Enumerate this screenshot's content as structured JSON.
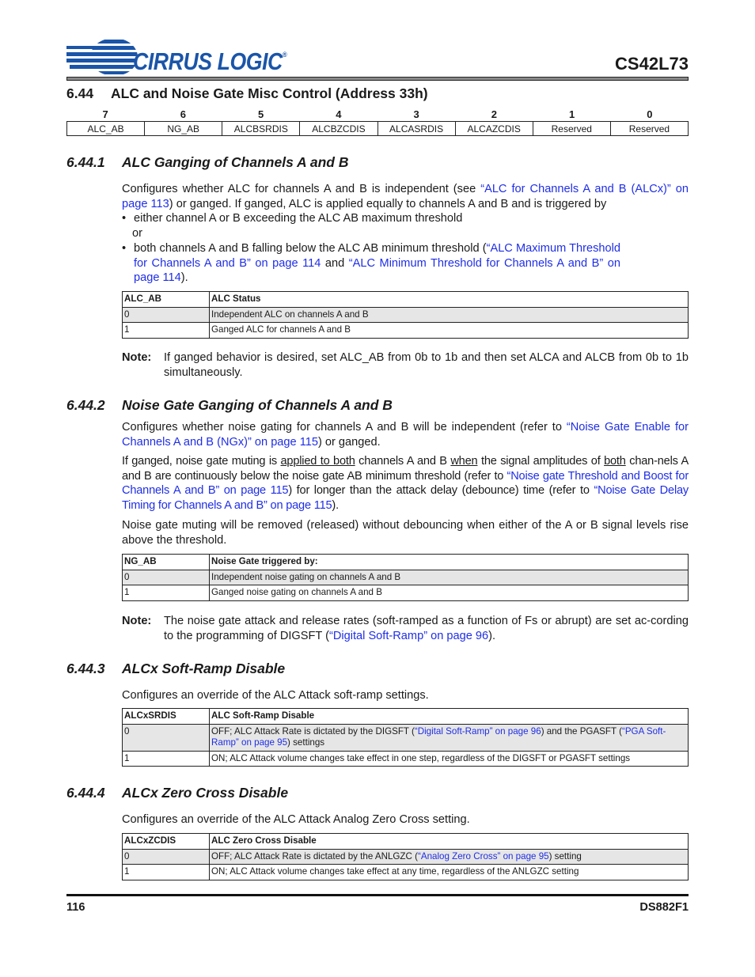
{
  "header": {
    "logo_text": "CIRRUS LOGIC",
    "logo_mark": "®",
    "part_number": "CS42L73"
  },
  "section": {
    "number": "6.44",
    "title": "ALC and Noise Gate Misc Control (Address 33h)"
  },
  "register": {
    "bits": [
      "7",
      "6",
      "5",
      "4",
      "3",
      "2",
      "1",
      "0"
    ],
    "fields": [
      "ALC_AB",
      "NG_AB",
      "ALCBSRDIS",
      "ALCBZCDIS",
      "ALCASRDIS",
      "ALCAZCDIS",
      "Reserved",
      "Reserved"
    ]
  },
  "sub1": {
    "number": "6.44.1",
    "title": "ALC Ganging of Channels A and B",
    "p1_a": "Configures whether ALC for channels A and B is independent (see ",
    "p1_link": "“ALC for Channels A and B (ALCx)” on page 113",
    "p1_b": ") or ganged. If ganged, ALC is applied equally to channels A and B and is triggered by",
    "bullet1": "either channel A or B exceeding the ALC AB maximum threshold",
    "or_text": "or",
    "bullet2_a": "both channels A and B falling below the ALC AB minimum threshold (",
    "bullet2_link1": "“ALC Maximum Threshold for Channels A and B” on page 114",
    "bullet2_mid": " and ",
    "bullet2_link2": "“ALC Minimum Threshold for Channels A and B” on page 114",
    "bullet2_end": ").",
    "bullet_glyph": "•",
    "table": {
      "headers": [
        "ALC_AB",
        "ALC Status"
      ],
      "rows": [
        [
          "0",
          "Independent ALC on channels A and B"
        ],
        [
          "1",
          "Ganged ALC for channels A and B"
        ]
      ]
    },
    "note_label": "Note:",
    "note_text": "If ganged behavior is desired, set ALC_AB from 0b to 1b and then set ALCA and ALCB from 0b to 1b simultaneously."
  },
  "sub2": {
    "number": "6.44.2",
    "title": "Noise Gate Ganging of Channels A and B",
    "p1_a": "Configures whether noise gating for channels A and B will be independent (refer to ",
    "p1_link": "“Noise Gate Enable for Channels A and B (NGx)” on page 115",
    "p1_b": ") or ganged.",
    "p2_a": "If ganged, noise gate muting is ",
    "p2_u1": "applied to both",
    "p2_b": " channels A and B ",
    "p2_u2": "when",
    "p2_c": " the signal amplitudes of ",
    "p2_u3": "both",
    "p2_d": " chan-nels A and B are continuously below the noise gate AB minimum threshold (refer to ",
    "p2_link1": "“Noise gate Threshold and Boost for Channels A and B” on page 115",
    "p2_e": ") for longer than the attack delay (debounce) time (refer to ",
    "p2_link2": "“Noise Gate Delay Timing for Channels A and B” on page 115",
    "p2_f": ").",
    "p3": "Noise gate muting will be removed (released) without debouncing when either of the A or B signal levels rise above the threshold.",
    "table": {
      "headers": [
        "NG_AB",
        "Noise Gate triggered by:"
      ],
      "rows": [
        [
          "0",
          "Independent noise gating on channels A and B"
        ],
        [
          "1",
          "Ganged noise gating on channels A and B"
        ]
      ]
    },
    "note_label": "Note:",
    "note_a": "The noise gate attack and release rates (soft-ramped as a function of Fs or abrupt) are set ac-cording to the programming of DIGSFT (",
    "note_link": "“Digital Soft-Ramp” on page 96",
    "note_b": ")."
  },
  "sub3": {
    "number": "6.44.3",
    "title": "ALCx Soft-Ramp Disable",
    "p1": "Configures an override of the ALC Attack soft-ramp settings.",
    "table": {
      "headers": [
        "ALCxSRDIS",
        "ALC Soft-Ramp Disable"
      ],
      "row0_val": "0",
      "row0_a": "OFF; ALC Attack Rate is dictated by the DIGSFT (",
      "row0_link1": "“Digital Soft-Ramp” on page 96",
      "row0_b": ") and the PGASFT (",
      "row0_link2": "“PGA Soft-Ramp” on page 95",
      "row0_c": ") settings",
      "row1_val": "1",
      "row1_text": "ON; ALC Attack volume changes take effect in one step, regardless of the DIGSFT or PGASFT settings"
    }
  },
  "sub4": {
    "number": "6.44.4",
    "title": "ALCx Zero Cross Disable",
    "p1": "Configures an override of the ALC Attack Analog Zero Cross setting.",
    "table": {
      "headers": [
        "ALCxZCDIS",
        "ALC Zero Cross Disable"
      ],
      "row0_val": "0",
      "row0_a": "OFF; ALC Attack Rate is dictated by the ANLGZC (",
      "row0_link": "“Analog Zero Cross” on page 95",
      "row0_b": ") setting",
      "row1_val": "1",
      "row1_text": "ON; ALC Attack volume changes take effect at any time, regardless of the ANLGZC setting"
    }
  },
  "footer": {
    "page_number": "116",
    "doc_id": "DS882F1"
  }
}
